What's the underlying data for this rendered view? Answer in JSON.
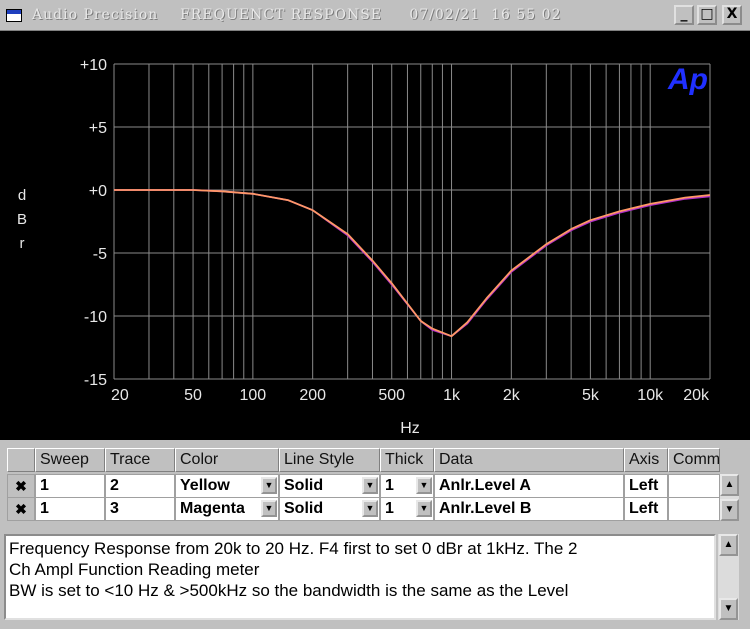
{
  "window": {
    "title": "Audio Precision    FREQUENCT RESPONSE     07/02/21  16 55 02",
    "controls": [
      "_",
      "□",
      "X"
    ]
  },
  "graph": {
    "y_axis_label": [
      "d",
      "B",
      "r"
    ],
    "x_axis_label": "Hz",
    "y_ticks": [
      "+10",
      "+5",
      "+0",
      "-5",
      "-10",
      "-15"
    ],
    "x_ticks": [
      "20",
      "50",
      "100",
      "200",
      "500",
      "1k",
      "2k",
      "5k",
      "10k",
      "20k"
    ],
    "logo": "Ap",
    "colors": {
      "background": "#000000",
      "grid": "#8a8a8a",
      "yellow_trace": "#ff9966",
      "magenta_trace": "#b030c8",
      "logo": "#2030ff"
    }
  },
  "chart_data": {
    "type": "line",
    "x_scale": "log",
    "xlim": [
      20,
      20000
    ],
    "ylim": [
      -15,
      10
    ],
    "xlabel": "Hz",
    "ylabel": "dBr",
    "grid": true,
    "series": [
      {
        "color": "yellow",
        "x": [
          20,
          50,
          70,
          100,
          150,
          200,
          300,
          400,
          500,
          700,
          800,
          1000,
          1200,
          1500,
          2000,
          3000,
          4000,
          5000,
          7000,
          10000,
          15000,
          20000
        ],
        "values": [
          0,
          0,
          -0.1,
          -0.3,
          -0.8,
          -1.6,
          -3.5,
          -5.6,
          -7.4,
          -10.4,
          -11,
          -11.6,
          -10.5,
          -8.6,
          -6.4,
          -4.3,
          -3.1,
          -2.4,
          -1.7,
          -1.1,
          -0.6,
          -0.4
        ]
      },
      {
        "color": "magenta",
        "x": [
          20,
          50,
          70,
          100,
          150,
          200,
          300,
          400,
          500,
          700,
          800,
          1000,
          1200,
          1500,
          2000,
          3000,
          4000,
          5000,
          7000,
          10000,
          15000,
          20000
        ],
        "values": [
          0,
          0,
          -0.1,
          -0.3,
          -0.8,
          -1.6,
          -3.6,
          -5.7,
          -7.5,
          -10.4,
          -11.1,
          -11.6,
          -10.6,
          -8.7,
          -6.5,
          -4.4,
          -3.2,
          -2.5,
          -1.8,
          -1.2,
          -0.7,
          -0.5
        ]
      }
    ]
  },
  "trace_table": {
    "headers": [
      "Sweep",
      "Trace",
      "Color",
      "Line Style",
      "Thick",
      "Data",
      "Axis",
      "Comm"
    ],
    "rows": [
      {
        "sweep": "1",
        "trace": "2",
        "color": "Yellow",
        "line_style": "Solid",
        "thick": "1",
        "data": "Anlr.Level A",
        "axis": "Left",
        "comment": ""
      },
      {
        "sweep": "1",
        "trace": "3",
        "color": "Magenta",
        "line_style": "Solid",
        "thick": "1",
        "data": "Anlr.Level B",
        "axis": "Left",
        "comment": ""
      }
    ]
  },
  "notes": {
    "lines": [
      "Frequency Response from 20k to 20 Hz.  F4 first to set 0 dBr at 1kHz.  The 2",
      "Ch Ampl Function Reading meter",
      "BW is set to <10 Hz & >500kHz so the bandwidth is the same as the Level"
    ]
  }
}
